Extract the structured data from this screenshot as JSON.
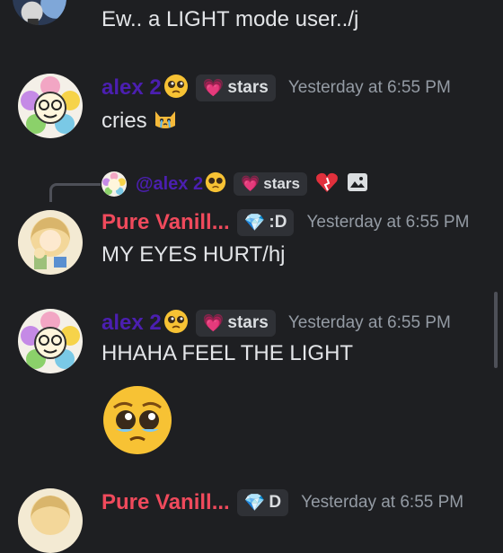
{
  "messages": [
    {
      "text": "Ew.. a LIGHT mode user../j"
    },
    {
      "author": "alex 2",
      "badge_label": "stars",
      "timestamp": "Yesterday at 6:55 PM",
      "text": "cries"
    },
    {
      "reply": {
        "author": "@alex 2",
        "badge_label": "stars"
      },
      "author": "Pure Vanill...",
      "badge_label": ":D",
      "timestamp": "Yesterday at 6:55 PM",
      "text": "MY EYES HURT/hj"
    },
    {
      "author": "alex 2",
      "badge_label": "stars",
      "timestamp": "Yesterday at 6:55 PM",
      "text": "HHAHA FEEL THE LIGHT"
    },
    {
      "author": "Pure Vanill...",
      "badge_label": "D",
      "timestamp": "Yesterday at 6:55 PM"
    }
  ],
  "colors": {
    "background": "#1e1f22",
    "alex_name": "#4b1fb0",
    "vanilla_name": "#f04a5c",
    "timestamp": "#949ba4"
  },
  "icons": [
    "pleading-face-emoji",
    "crying-cat-emoji",
    "heart-on-fire-emoji",
    "image-icon",
    "pink-heart-icon",
    "gem-icon"
  ]
}
